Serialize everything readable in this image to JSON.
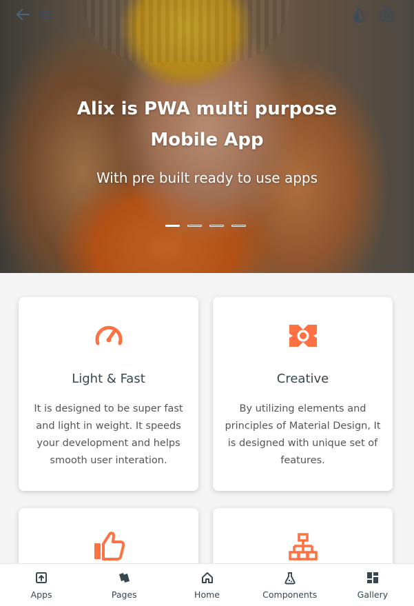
{
  "colors": {
    "accent": "#ff7043",
    "card_title": "#37474f",
    "card_text": "#555555",
    "nav_text": "#37474f",
    "background": "#f4f4f4"
  },
  "header": {
    "back_icon": "arrow-left-icon",
    "menu_icon": "hamburger-menu-icon",
    "theme_icon": "water-drop-icon",
    "settings_icon": "gear-icon"
  },
  "hero": {
    "title_line1": "Alix is PWA multi purpose",
    "title_line2": "Mobile App",
    "subtitle": "With pre built ready to use apps",
    "slides_count": 4,
    "active_slide": 1
  },
  "features": [
    {
      "icon": "speedometer-icon",
      "title": "Light & Fast",
      "description": "It is designed to be super fast and light in weight. It speeds your development and helps smooth user interation."
    },
    {
      "icon": "aperture-icon",
      "title": "Creative",
      "description": "By utilizing elements and principles of Material Design, It is designed with unique set of features."
    },
    {
      "icon": "thumbs-up-icon",
      "title": "",
      "description": ""
    },
    {
      "icon": "sitemap-icon",
      "title": "",
      "description": ""
    }
  ],
  "bottom_nav": [
    {
      "label": "Apps",
      "icon": "apps-upload-box-icon"
    },
    {
      "label": "Pages",
      "icon": "pages-stack-icon"
    },
    {
      "label": "Home",
      "icon": "home-icon"
    },
    {
      "label": "Components",
      "icon": "flask-icon"
    },
    {
      "label": "Gallery",
      "icon": "gallery-grid-icon"
    }
  ]
}
